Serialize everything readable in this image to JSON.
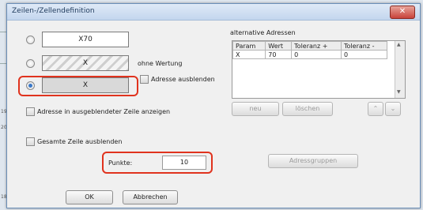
{
  "dialog": {
    "title": "Zeilen-/Zellendefinition",
    "close_label": "✕"
  },
  "options": [
    {
      "value": "X70",
      "selected": false
    },
    {
      "value": "X",
      "selected": false,
      "note": "ohne Wertung"
    },
    {
      "value": "X",
      "selected": true,
      "checkbox_label": "Adresse ausblenden"
    }
  ],
  "checkboxes": {
    "show_hidden_address": "Adresse in ausgeblendeter Zeile anzeigen",
    "hide_row": "Gesamte Zeile ausblenden"
  },
  "points": {
    "label": "Punkte:",
    "value": "10"
  },
  "alt_addresses": {
    "title": "alternative Adressen",
    "columns": [
      "Param",
      "Wert",
      "Toleranz +",
      "Toleranz -"
    ],
    "rows": [
      [
        "X",
        "70",
        "0",
        "0"
      ]
    ],
    "new_label": "neu",
    "delete_label": "löschen",
    "up_label": "⌃",
    "down_label": "⌄"
  },
  "address_groups_label": "Adressgruppen",
  "footer": {
    "ok_label": "OK",
    "cancel_label": "Abbrechen"
  },
  "background_numbers": [
    "19",
    "20",
    "18"
  ]
}
